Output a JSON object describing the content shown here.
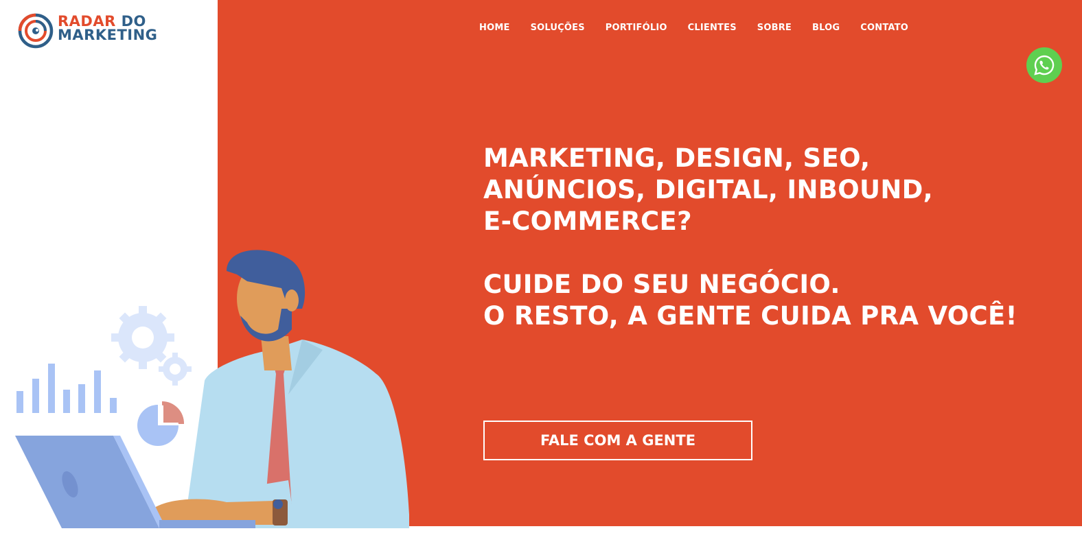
{
  "logo": {
    "line1_a": "RADAR",
    "line1_b": "DO",
    "line2": "MARKETING",
    "colors": {
      "primary": "#e24b2c",
      "secondary": "#2f5f89"
    }
  },
  "nav": {
    "items": [
      {
        "label": "HOME"
      },
      {
        "label": "SOLUÇÕES"
      },
      {
        "label": "PORTIFÓLIO"
      },
      {
        "label": "CLIENTES"
      },
      {
        "label": "SOBRE"
      },
      {
        "label": "BLOG"
      },
      {
        "label": "CONTATO"
      }
    ]
  },
  "hero": {
    "line1": "MARKETING, DESIGN, SEO,",
    "line2": "ANÚNCIOS, DIGITAL, INBOUND,",
    "line3": "E-COMMERCE?",
    "line4": "CUIDE DO SEU NEGÓCIO.",
    "line5": "O RESTO, A GENTE CUIDA PRA VOCÊ!",
    "cta_label": "FALE COM A GENTE",
    "background_color": "#e24b2c"
  },
  "whatsapp": {
    "icon": "whatsapp-icon",
    "color": "#5fcf50"
  },
  "illustration": {
    "icon": "businessman-laptop-illustration"
  }
}
